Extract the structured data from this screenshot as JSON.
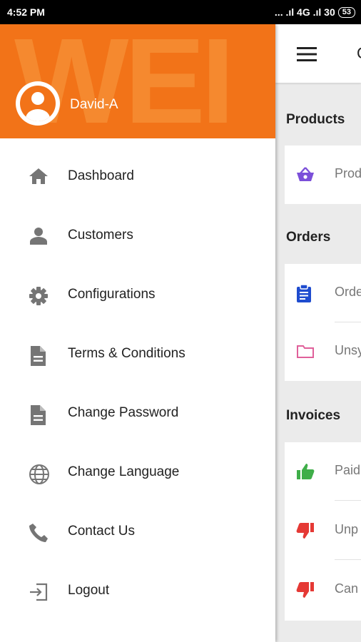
{
  "status_bar": {
    "time": "4:52 PM",
    "signal": "... .ıl 4G .ıl 30",
    "battery": "53"
  },
  "drawer": {
    "watermark": "WEI",
    "user_name": "David-A",
    "items": [
      {
        "label": "Dashboard",
        "icon": "home-icon"
      },
      {
        "label": "Customers",
        "icon": "person-icon"
      },
      {
        "label": "Configurations",
        "icon": "gear-icon"
      },
      {
        "label": "Terms & Conditions",
        "icon": "document-icon"
      },
      {
        "label": "Change Password",
        "icon": "document-icon"
      },
      {
        "label": "Change Language",
        "icon": "globe-icon"
      },
      {
        "label": "Contact Us",
        "icon": "phone-icon"
      },
      {
        "label": "Logout",
        "icon": "logout-icon"
      }
    ]
  },
  "app": {
    "title": "C",
    "sections": {
      "products": {
        "title": "Products",
        "items": [
          {
            "label": "Prod",
            "icon": "basket-icon",
            "color": "#7b4fd9"
          }
        ]
      },
      "orders": {
        "title": "Orders",
        "items": [
          {
            "label": "Orde",
            "icon": "clipboard-icon",
            "color": "#1f4ccf"
          },
          {
            "label": "Unsy",
            "icon": "folder-icon",
            "color": "#e0609a"
          }
        ]
      },
      "invoices": {
        "title": "Invoices",
        "items": [
          {
            "label": "Paid",
            "icon": "thumbs-up-icon",
            "color": "#3fae49"
          },
          {
            "label": "Unp",
            "icon": "thumbs-down-icon",
            "color": "#e53935"
          },
          {
            "label": "Can",
            "icon": "thumbs-down-icon",
            "color": "#e53935"
          }
        ]
      }
    }
  },
  "colors": {
    "header_orange": "#f27318",
    "icon_grey": "#757575"
  }
}
